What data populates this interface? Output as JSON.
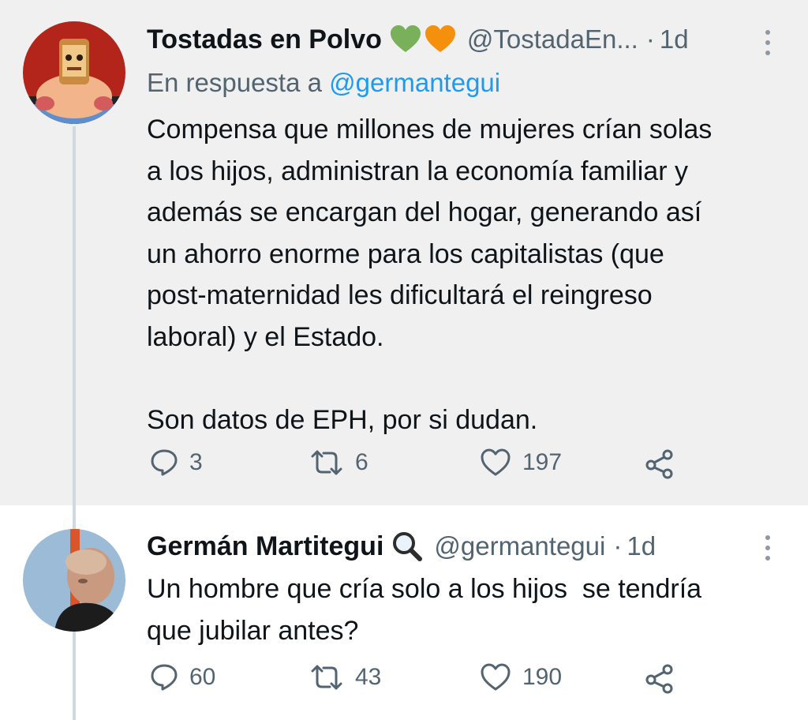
{
  "tweets": [
    {
      "author_name": "Tostadas en Polvo",
      "handle": "@TostadaEn...",
      "separator": "·",
      "time": "1d",
      "reply_prefix": "En respuesta a",
      "reply_mention": "@germantegui",
      "text": "Compensa que millones de mujeres crían solas\na los hijos, administran la economía familiar y\nademás se encargan del hogar, generando así\nun ahorro enorme para los capitalistas (que\npost-maternidad les dificultará el reingreso\nlaboral) y el Estado.\n\nSon datos de EPH, por si dudan.",
      "replies": "3",
      "retweets": "6",
      "likes": "197",
      "badges": [
        "green-heart-icon",
        "orange-heart-icon"
      ],
      "colors": {
        "green_heart": "#78b159",
        "orange_heart": "#f4900c"
      }
    },
    {
      "author_name": "Germán Martitegui",
      "handle": "@germantegui",
      "separator": "·",
      "time": "1d",
      "text": "Un hombre que cría solo a los hijos  se tendría\nque jubilar antes?",
      "replies": "60",
      "retweets": "43",
      "likes": "190",
      "badges": [
        "magnifying-glass-icon"
      ]
    }
  ],
  "colors": {
    "text": "#0f1419",
    "secondary": "#536471",
    "link": "#1d9bf0",
    "highlight_bg": "#f0f0f0"
  }
}
